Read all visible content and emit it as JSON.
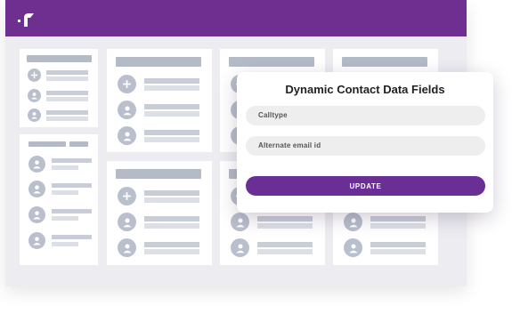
{
  "app": {
    "brand_color": "#6f2f91",
    "logo_icon": "app-logo-icon"
  },
  "dialog": {
    "title": "Dynamic Contact Data Fields",
    "fields": [
      {
        "label": "Calltype"
      },
      {
        "label": "Alternate email id"
      }
    ],
    "update_label": "UPDATE",
    "button_color": "#6a2f95"
  }
}
